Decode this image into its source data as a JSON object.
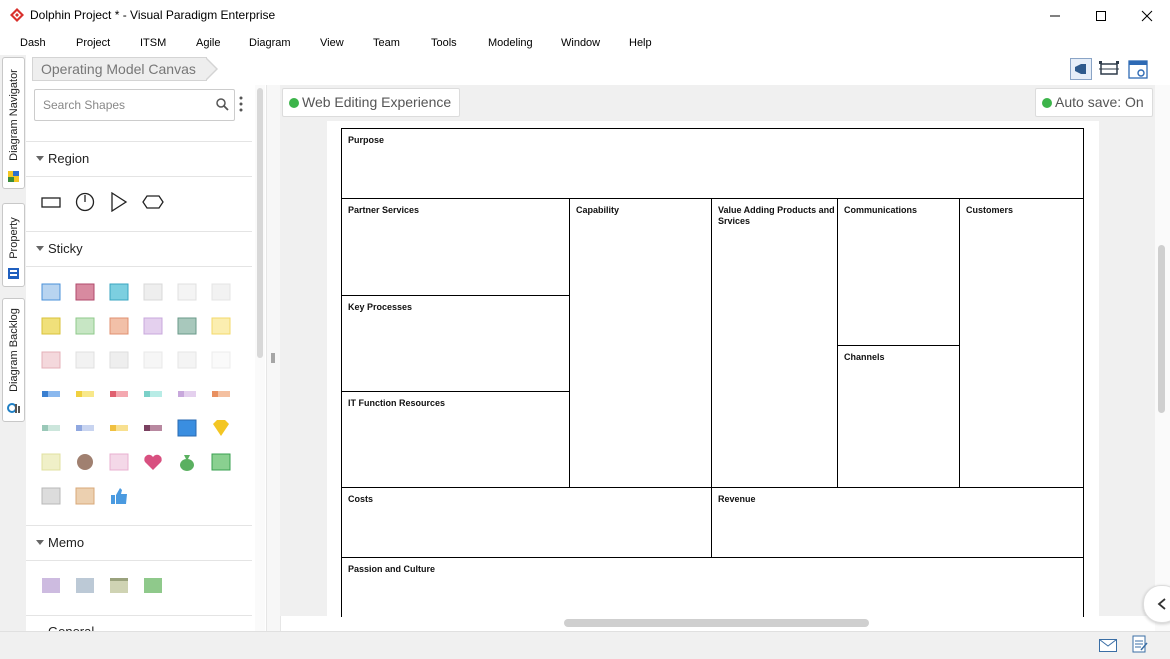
{
  "window": {
    "title": "Dolphin Project * - Visual Paradigm Enterprise",
    "controls": [
      "minimize",
      "maximize",
      "close"
    ]
  },
  "menu": [
    "Dash",
    "Project",
    "ITSM",
    "Agile",
    "Diagram",
    "View",
    "Team",
    "Tools",
    "Modeling",
    "Window",
    "Help"
  ],
  "left_tabs": [
    {
      "label": "Diagram Navigator",
      "icon": "diagram-navigator-icon"
    },
    {
      "label": "Property",
      "icon": "property-icon"
    },
    {
      "label": "Diagram Backlog",
      "icon": "backlog-icon"
    }
  ],
  "breadcrumb": "Operating Model Canvas",
  "search": {
    "placeholder": "Search Shapes",
    "value": ""
  },
  "palette": {
    "sections": [
      {
        "label": "Region",
        "expanded": true
      },
      {
        "label": "Sticky",
        "expanded": true
      },
      {
        "label": "Memo",
        "expanded": true
      },
      {
        "label": "General",
        "expanded": false
      }
    ]
  },
  "status": {
    "web_editing": "Web Editing Experience",
    "autosave": "Auto save: On"
  },
  "canvas": {
    "purpose": "Purpose",
    "partner_services": "Partner Services",
    "capability": "Capability",
    "value_adding": "Value Adding Products and Srvices",
    "communications": "Communications",
    "customers": "Customers",
    "key_processes": "Key Processes",
    "channels": "Channels",
    "it_function": "IT Function Resources",
    "costs": "Costs",
    "revenue": "Revenue",
    "passion": "Passion and Culture"
  },
  "colors": {
    "accent_green": "#3cb44a",
    "logo_red": "#d9302c"
  }
}
